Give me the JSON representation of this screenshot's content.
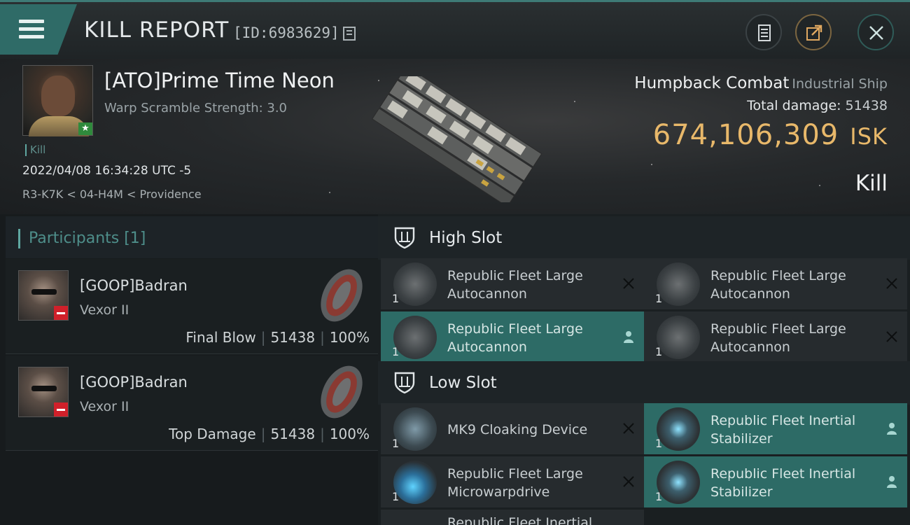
{
  "header": {
    "title": "KILL REPORT",
    "report_id": "[ID:6983629]"
  },
  "victim": {
    "name": "[ATO]Prime Time Neon",
    "warp_scramble": "Warp Scramble Strength: 3.0",
    "tag": "Kill",
    "datetime": "2022/04/08 16:34:28 UTC -5",
    "location": "R3-K7K < 04-H4M < Providence"
  },
  "ship": {
    "name": "Humpback Combat",
    "class": "Industrial Ship",
    "total_damage_label": "Total damage:",
    "total_damage": "51438",
    "isk_value": "674,106,309",
    "isk_unit": "ISK",
    "kill_type": "Kill"
  },
  "participants": {
    "label": "Participants [1]",
    "cards": [
      {
        "name": "[GOOP]Badran",
        "ship": "Vexor II",
        "role": "Final Blow",
        "damage": "51438",
        "percent": "100%"
      },
      {
        "name": "[GOOP]Badran",
        "ship": "Vexor II",
        "role": "Top Damage",
        "damage": "51438",
        "percent": "100%"
      }
    ]
  },
  "slots": {
    "high_label": "High Slot",
    "low_label": "Low Slot",
    "high": [
      {
        "name": "Republic Fleet Large Autocannon",
        "qty": "1",
        "status": "destroyed"
      },
      {
        "name": "Republic Fleet Large Autocannon",
        "qty": "1",
        "status": "destroyed"
      },
      {
        "name": "Republic Fleet Large Autocannon",
        "qty": "1",
        "status": "dropped"
      },
      {
        "name": "Republic Fleet Large Autocannon",
        "qty": "1",
        "status": "destroyed"
      }
    ],
    "low": [
      {
        "name": "MK9 Cloaking Device",
        "qty": "1",
        "status": "destroyed"
      },
      {
        "name": "Republic Fleet Inertial Stabilizer",
        "qty": "1",
        "status": "dropped"
      },
      {
        "name": "Republic Fleet Large Microwarpdrive",
        "qty": "1",
        "status": "destroyed"
      },
      {
        "name": "Republic Fleet Inertial Stabilizer",
        "qty": "1",
        "status": "dropped"
      }
    ],
    "partial_label": "Republic Fleet Inertial"
  },
  "colors": {
    "accent": "#2d6b66",
    "isk": "#e8b86a",
    "negative_standing": "#d0202a",
    "positive_standing": "#2f8a3c"
  },
  "icons": [
    "menu-icon",
    "copy-icon",
    "document-icon",
    "share-icon",
    "close-icon",
    "shield-slot-icon",
    "destroyed-x-icon",
    "dropped-person-icon"
  ]
}
